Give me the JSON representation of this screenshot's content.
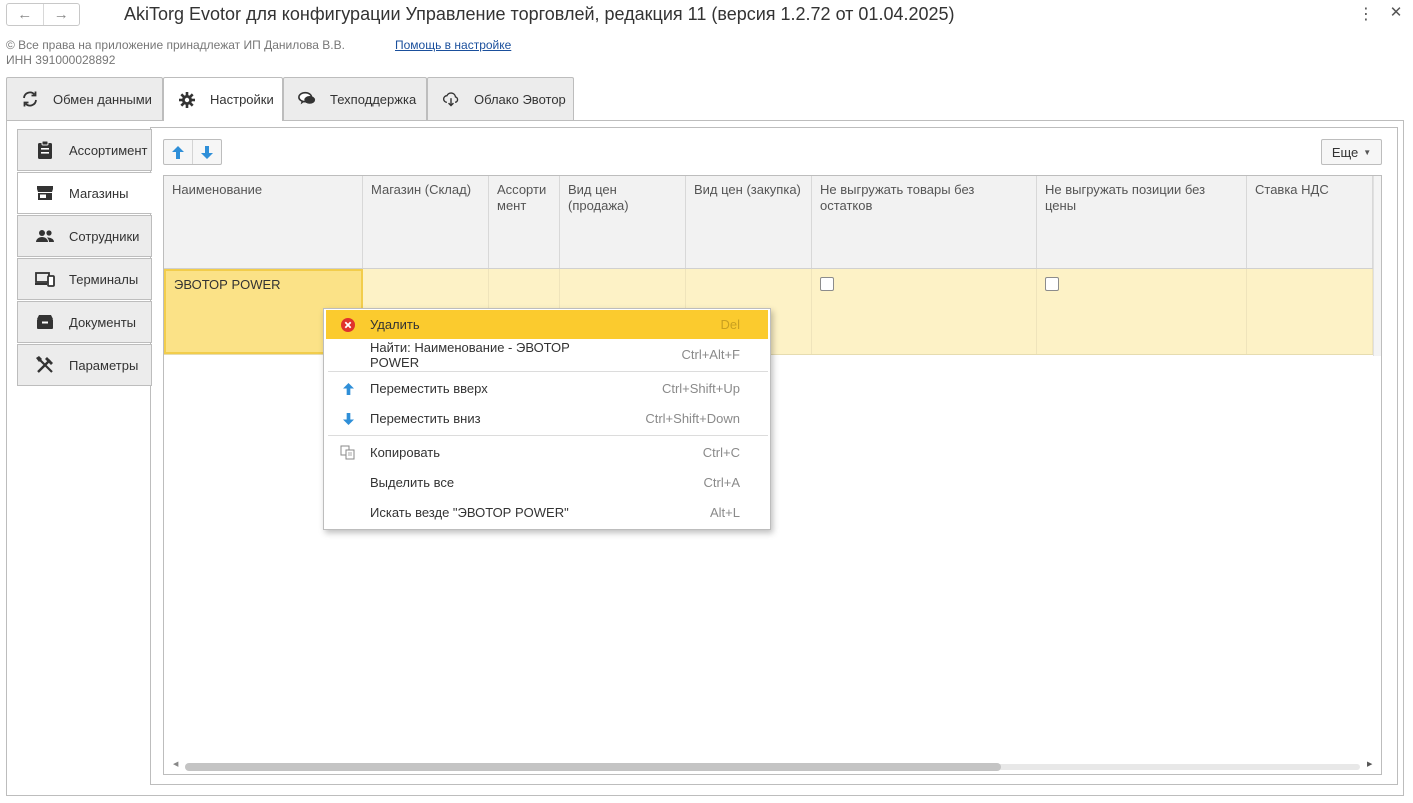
{
  "window": {
    "title": "AkiTorg Evotor для конфигурации Управление торговлей, редакция 11 (версия 1.2.72 от 01.04.2025)",
    "nav_back": "←",
    "nav_forward": "→",
    "menu": "⋮",
    "close": "✕"
  },
  "info": {
    "copyright": "© Все права на приложение принадлежат ИП Данилова В.В.",
    "inn": "ИНН 391000028892",
    "help_link": "Помощь в настройке"
  },
  "tabs": [
    {
      "label": "Обмен данными",
      "icon": "sync-icon"
    },
    {
      "label": "Настройки",
      "icon": "gear-icon",
      "active": true
    },
    {
      "label": "Техподдержка",
      "icon": "chat-icon"
    },
    {
      "label": "Облако Эвотор",
      "icon": "cloud-icon"
    }
  ],
  "side_tabs": [
    {
      "label": "Ассортимент",
      "icon": "clipboard-icon"
    },
    {
      "label": "Магазины",
      "icon": "store-icon",
      "active": true
    },
    {
      "label": "Сотрудники",
      "icon": "people-icon"
    },
    {
      "label": "Терминалы",
      "icon": "devices-icon"
    },
    {
      "label": "Документы",
      "icon": "archive-icon"
    },
    {
      "label": "Параметры",
      "icon": "tools-icon"
    }
  ],
  "toolbar": {
    "more_label": "Еще"
  },
  "table": {
    "columns": [
      "Наименование",
      "Магазин (Склад)",
      "Ассорти мент",
      "Вид цен (продажа)",
      "Вид цен (закупка)",
      "Не выгружать товары без остатков",
      "Не выгружать позиции без цены",
      "Ставка НДС"
    ],
    "rows": [
      {
        "name": "ЭВОТОР POWER",
        "store": "",
        "assortment": "",
        "price_sale": "",
        "price_purchase": "",
        "skip_no_stock": false,
        "skip_no_price": false,
        "vat": ""
      }
    ]
  },
  "context_menu": {
    "items": [
      {
        "label": "Удалить",
        "shortcut": "Del",
        "icon": "delete-icon",
        "highlighted": true
      },
      {
        "label": "Найти: Наименование - ЭВОТОР POWER",
        "shortcut": "Ctrl+Alt+F"
      },
      {
        "label": "Переместить вверх",
        "shortcut": "Ctrl+Shift+Up",
        "icon": "arrow-up-icon"
      },
      {
        "label": "Переместить вниз",
        "shortcut": "Ctrl+Shift+Down",
        "icon": "arrow-down-icon"
      },
      {
        "label": "Копировать",
        "shortcut": "Ctrl+C",
        "icon": "copy-icon"
      },
      {
        "label": "Выделить все",
        "shortcut": "Ctrl+A"
      },
      {
        "label": "Искать везде \"ЭВОТОР POWER\"",
        "shortcut": "Alt+L"
      }
    ]
  },
  "colors": {
    "accent_highlight": "#fbcb2e",
    "row_bg": "#fdf2c6",
    "selected_cell": "#fbe287",
    "arrow_blue": "#2f8fd8",
    "delete_red": "#e0322c"
  }
}
